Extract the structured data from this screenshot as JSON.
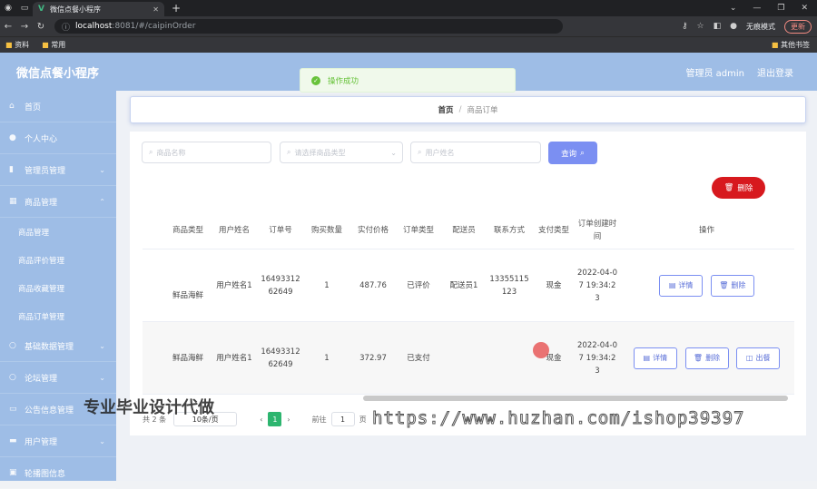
{
  "browser": {
    "tab_title": "微信点餐小程序",
    "url_host": "localhost",
    "url_path": ":8081/#/caipinOrder",
    "incognito_label": "无痕模式",
    "update_label": "更新",
    "bookmarks": [
      "资料",
      "常用"
    ],
    "bookmarks_right": "其他书签"
  },
  "app": {
    "title": "微信点餐小程序",
    "user_label": "管理员 admin",
    "logout_label": "退出登录"
  },
  "sidebar": {
    "items": [
      {
        "label": "首页",
        "icon": "home-icon"
      },
      {
        "label": "个人中心",
        "icon": "user-icon"
      },
      {
        "label": "管理员管理",
        "icon": "bar-icon"
      },
      {
        "label": "商品管理",
        "icon": "grid-icon"
      }
    ],
    "sub_items": [
      "商品管理",
      "商品评价管理",
      "商品收藏管理",
      "商品订单管理"
    ],
    "items_after": [
      {
        "label": "基础数据管理"
      },
      {
        "label": "论坛管理"
      },
      {
        "label": "公告信息管理"
      },
      {
        "label": "用户管理"
      },
      {
        "label": "轮播图信息"
      }
    ]
  },
  "breadcrumb": {
    "home": "首页",
    "current": "商品订单"
  },
  "toast": {
    "message": "操作成功"
  },
  "search": {
    "name_placeholder": "商品名称",
    "type_placeholder": "请选择商品类型",
    "user_placeholder": "用户姓名",
    "search_label": "查询",
    "delete_label": "删除"
  },
  "table": {
    "headers": [
      "商品类型",
      "用户姓名",
      "订单号",
      "购买数量",
      "实付价格",
      "订单类型",
      "配送员",
      "联系方式",
      "支付类型",
      "订单创建时间",
      "操作"
    ],
    "rows": [
      {
        "type": "鲜品海鲜",
        "user": "用户姓名1",
        "order_no": "1649331262649",
        "qty": "1",
        "price": "487.76",
        "status": "已评价",
        "courier": "配送员1",
        "phone": "13355115123",
        "pay": "现金",
        "time": "2022-04-07 19:34:23",
        "actions": [
          "详情",
          "删除"
        ]
      },
      {
        "type": "鲜品海鲜",
        "user": "用户姓名1",
        "order_no": "1649331262649",
        "qty": "1",
        "price": "372.97",
        "status": "已支付",
        "courier": "",
        "phone": "",
        "pay": "现金",
        "time": "2022-04-07 19:34:23",
        "actions": [
          "详情",
          "删除",
          "出餐"
        ]
      }
    ]
  },
  "pager": {
    "total": "共 2 条",
    "page_size": "10条/页",
    "current": "1",
    "jump_label": "前往",
    "jump_value": "1",
    "page_suffix": "页"
  },
  "watermark": {
    "left": "专业毕业设计代做",
    "right": "https://www.huzhan.com/ishop39397"
  }
}
